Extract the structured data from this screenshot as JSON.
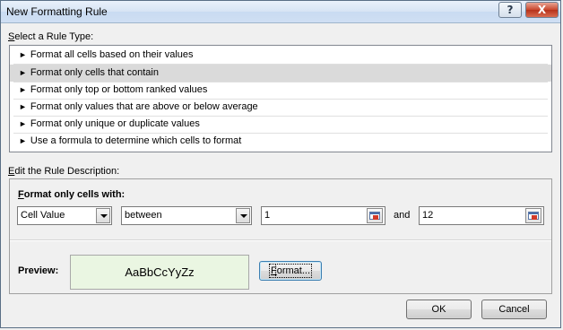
{
  "window": {
    "title": "New Formatting Rule",
    "help_label": "?",
    "close_label": "X"
  },
  "rule_type": {
    "label_prefix": "S",
    "label_rest": "elect a Rule Type:",
    "items": [
      {
        "label": "Format all cells based on their values"
      },
      {
        "label": "Format only cells that contain"
      },
      {
        "label": "Format only top or bottom ranked values"
      },
      {
        "label": "Format only values that are above or below average"
      },
      {
        "label": "Format only unique or duplicate values"
      },
      {
        "label": "Use a formula to determine which cells to format"
      }
    ],
    "selected_index": 1
  },
  "description": {
    "label_prefix": "E",
    "label_rest": "dit the Rule Description:",
    "format_label_prefix": "F",
    "format_label_rest": "ormat only cells with:",
    "condition_type": "Cell Value",
    "operator": "between",
    "value1": "1",
    "joiner": "and",
    "value2": "12",
    "preview_label": "Preview:",
    "preview_sample": "AaBbCcYyZz",
    "format_button_prefix": "F",
    "format_button_rest": "ormat..."
  },
  "footer": {
    "ok_label": "OK",
    "cancel_label": "Cancel"
  },
  "icons": {
    "arrow": "►",
    "dropdown": "chevron-down-icon",
    "range_picker": "range-picker-icon"
  }
}
